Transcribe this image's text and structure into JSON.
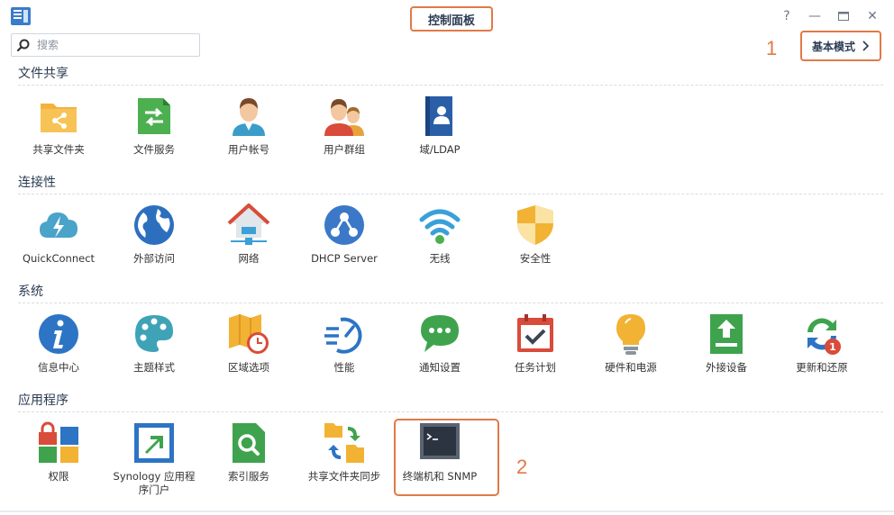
{
  "window": {
    "title": "控制面板",
    "controls": [
      "help-icon",
      "minimize-icon",
      "maximize-icon",
      "close-icon"
    ]
  },
  "search": {
    "placeholder": "搜索",
    "value": ""
  },
  "mode_button": {
    "label": "基本模式"
  },
  "annotations": {
    "one": "1",
    "two": "2"
  },
  "colors": {
    "highlight": "#e07a48",
    "title": "#2a3b52"
  },
  "sections": [
    {
      "title": "文件共享",
      "items": [
        {
          "label": "共享文件夹",
          "icon": "shared-folder-icon"
        },
        {
          "label": "文件服务",
          "icon": "file-services-icon"
        },
        {
          "label": "用户帐号",
          "icon": "user-icon"
        },
        {
          "label": "用户群组",
          "icon": "group-icon"
        },
        {
          "label": "域/LDAP",
          "icon": "ldap-icon"
        }
      ]
    },
    {
      "title": "连接性",
      "items": [
        {
          "label": "QuickConnect",
          "icon": "quickconnect-icon"
        },
        {
          "label": "外部访问",
          "icon": "globe-icon"
        },
        {
          "label": "网络",
          "icon": "network-icon"
        },
        {
          "label": "DHCP Server",
          "icon": "dhcp-icon"
        },
        {
          "label": "无线",
          "icon": "wifi-icon"
        },
        {
          "label": "安全性",
          "icon": "shield-icon"
        }
      ]
    },
    {
      "title": "系统",
      "items": [
        {
          "label": "信息中心",
          "icon": "info-icon"
        },
        {
          "label": "主题样式",
          "icon": "palette-icon"
        },
        {
          "label": "区域选项",
          "icon": "map-clock-icon"
        },
        {
          "label": "性能",
          "icon": "speedometer-icon"
        },
        {
          "label": "通知设置",
          "icon": "chat-icon"
        },
        {
          "label": "任务计划",
          "icon": "calendar-check-icon"
        },
        {
          "label": "硬件和电源",
          "icon": "bulb-icon"
        },
        {
          "label": "外接设备",
          "icon": "external-device-icon"
        },
        {
          "label": "更新和还原",
          "icon": "update-icon",
          "badge": "1"
        }
      ]
    },
    {
      "title": "应用程序",
      "items": [
        {
          "label": "权限",
          "icon": "privileges-icon"
        },
        {
          "label": "Synology 应用程序门户",
          "label_line1": "Synology 应用程",
          "label_line2": "序门户",
          "icon": "app-portal-icon"
        },
        {
          "label": "索引服务",
          "icon": "indexing-icon"
        },
        {
          "label": "共享文件夹同步",
          "icon": "folder-sync-icon"
        },
        {
          "label": "终端机和 SNMP",
          "icon": "terminal-icon"
        }
      ]
    }
  ]
}
